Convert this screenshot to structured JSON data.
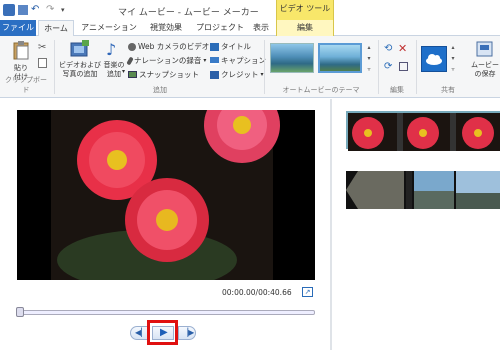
{
  "window": {
    "title": "マイ ムービー - ムービー メーカー",
    "context_tab_group": "ビデオ ツール"
  },
  "tabs": [
    "ファイル",
    "ホーム",
    "アニメーション",
    "視覚効果",
    "プロジェクト",
    "表示",
    "編集"
  ],
  "ribbon": {
    "clipboard": {
      "paste": "貼り\n付け",
      "group": "クリップボード"
    },
    "add": {
      "add_video": "ビデオおよび\n写真の追加",
      "add_music": "音楽の\n追加",
      "webcam": "Web カメラのビデオ",
      "narration": "ナレーションの録音",
      "snapshot": "スナップショット",
      "title": "タイトル",
      "caption": "キャプション",
      "credit": "クレジット",
      "group": "追加"
    },
    "themes": {
      "group": "オートムービーのテーマ"
    },
    "edit": {
      "group": "編集"
    },
    "share": {
      "save_movie": "ムービー\nの保存",
      "group": "共有"
    }
  },
  "player": {
    "time": "00:00.00/00:40.66",
    "progress": 0.0
  },
  "colors": {
    "file_tab": "#2b6fc3",
    "context_tab": "#f8e76a",
    "highlight": "#e01010"
  }
}
